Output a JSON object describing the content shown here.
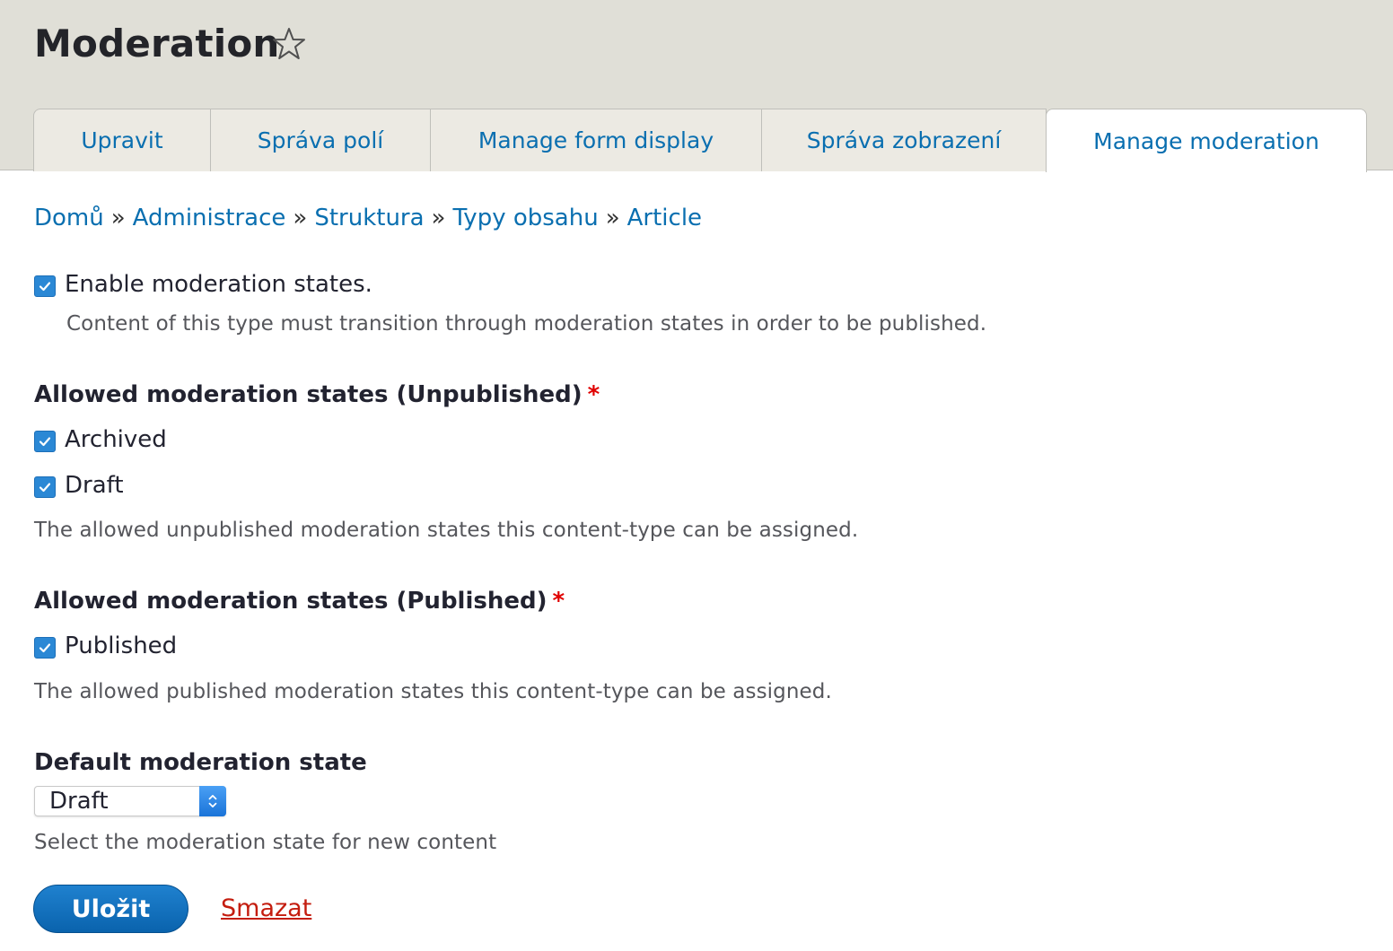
{
  "page": {
    "title": "Moderation"
  },
  "tabs": [
    {
      "label": "Upravit"
    },
    {
      "label": "Správa polí"
    },
    {
      "label": "Manage form display"
    },
    {
      "label": "Správa zobrazení"
    },
    {
      "label": "Manage moderation",
      "active": true
    }
  ],
  "breadcrumb": {
    "items": [
      "Domů",
      "Administrace",
      "Struktura",
      "Typy obsahu",
      "Article"
    ],
    "separator": "»"
  },
  "enable": {
    "label": "Enable moderation states.",
    "checked": true,
    "description": "Content of this type must transition through moderation states in order to be published."
  },
  "unpublished": {
    "title": "Allowed moderation states (Unpublished)",
    "required_mark": "*",
    "options": [
      {
        "label": "Archived",
        "checked": true
      },
      {
        "label": "Draft",
        "checked": true
      }
    ],
    "description": "The allowed unpublished moderation states this content-type can be assigned."
  },
  "published": {
    "title": "Allowed moderation states (Published)",
    "required_mark": "*",
    "options": [
      {
        "label": "Published",
        "checked": true
      }
    ],
    "description": "The allowed published moderation states this content-type can be assigned."
  },
  "default_state": {
    "title": "Default moderation state",
    "selected": "Draft",
    "description": "Select the moderation state for new content"
  },
  "actions": {
    "save_label": "Uložit",
    "delete_label": "Smazat"
  },
  "colors": {
    "link": "#0a6fb0",
    "header_bg": "#e0dfd7",
    "checkbox": "#2b88d5",
    "required": "#e00000",
    "button": "#0a63ad",
    "delete": "#c41d0f"
  },
  "icons": {
    "favorite": "star-outline-icon",
    "checkbox": "check-icon",
    "select": "up-down-chevron-icon"
  }
}
